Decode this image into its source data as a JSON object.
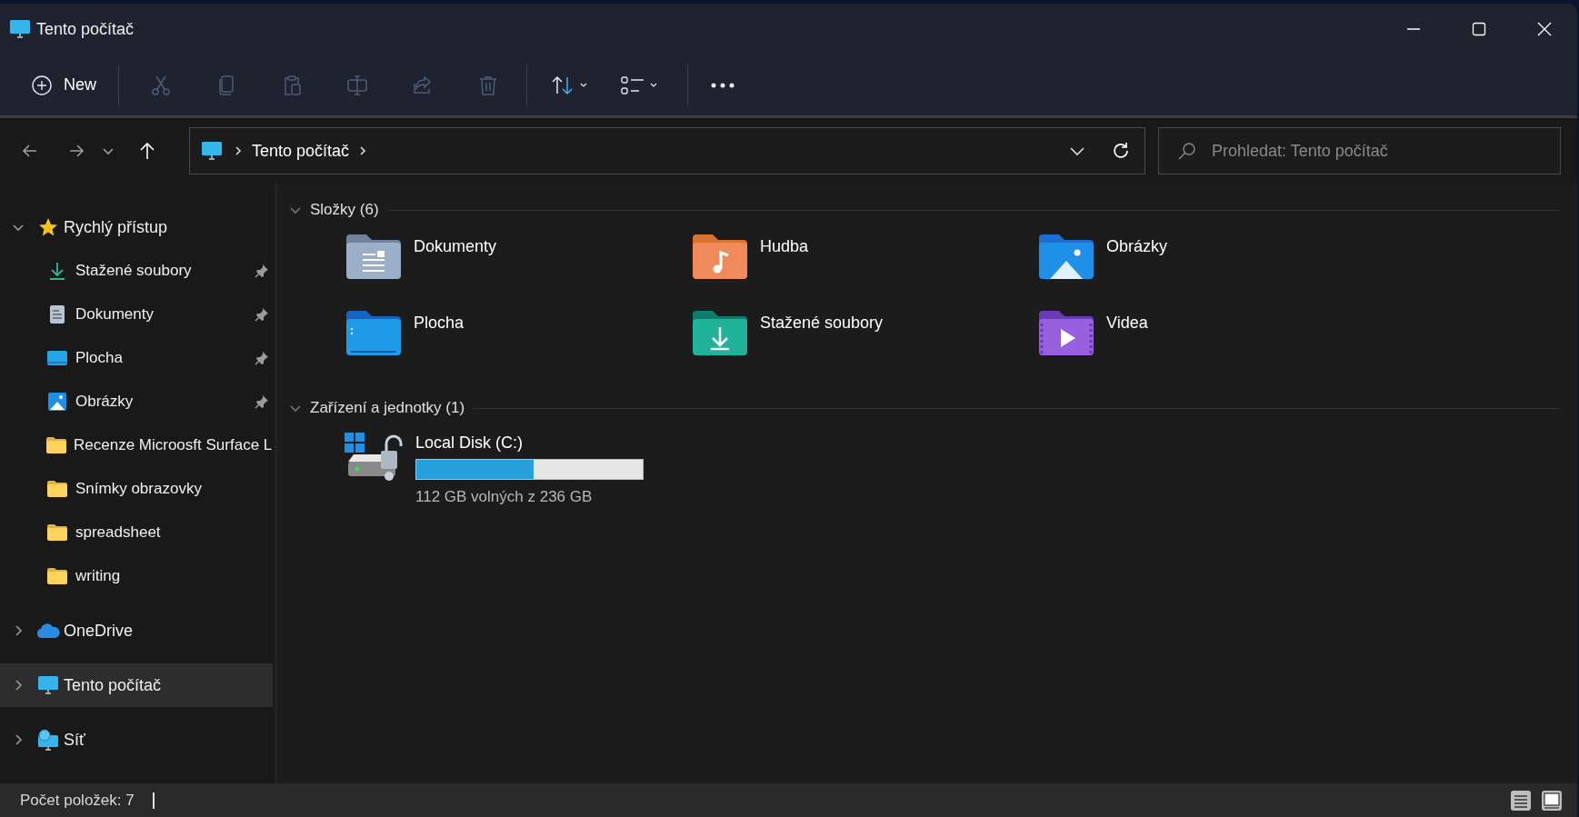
{
  "window": {
    "title": "Tento počítač"
  },
  "toolbar": {
    "items": [
      {
        "kind": "new",
        "label": "New",
        "disabled": false
      },
      {
        "kind": "cut",
        "disabled": true
      },
      {
        "kind": "copy",
        "disabled": true
      },
      {
        "kind": "paste",
        "disabled": true
      },
      {
        "kind": "rename",
        "disabled": true
      },
      {
        "kind": "share",
        "disabled": true
      },
      {
        "kind": "delete",
        "disabled": true
      },
      {
        "kind": "sort",
        "disabled": false
      },
      {
        "kind": "view",
        "disabled": false
      },
      {
        "kind": "more",
        "disabled": false
      }
    ]
  },
  "address_bar": {
    "breadcrumb": [
      "Tento počítač"
    ]
  },
  "search": {
    "placeholder": "Prohledat: Tento počítač"
  },
  "sidebar": {
    "items": [
      {
        "label": "Rychlý přístup",
        "kind": "star",
        "expanded": true,
        "selected": false,
        "children": [
          {
            "label": "Stažené soubory",
            "kind": "downloads",
            "pinned": true,
            "selected": false
          },
          {
            "label": "Dokumenty",
            "kind": "documents",
            "pinned": true,
            "selected": false
          },
          {
            "label": "Plocha",
            "kind": "desktop",
            "pinned": true,
            "selected": false
          },
          {
            "label": "Obrázky",
            "kind": "pictures",
            "pinned": true,
            "selected": false
          },
          {
            "label": "Recenze Microosft Surface L",
            "kind": "folder",
            "pinned": false,
            "selected": false
          },
          {
            "label": "Snímky obrazovky",
            "kind": "folder",
            "pinned": false,
            "selected": false
          },
          {
            "label": "spreadsheet",
            "kind": "folder",
            "pinned": false,
            "selected": false
          },
          {
            "label": "writing",
            "kind": "folder",
            "pinned": false,
            "selected": false
          }
        ]
      },
      {
        "label": "OneDrive",
        "kind": "cloud",
        "expanded": false,
        "selected": false
      },
      {
        "label": "Tento počítač",
        "kind": "pc",
        "expanded": false,
        "selected": true
      },
      {
        "label": "Síť",
        "kind": "network",
        "expanded": false,
        "selected": false
      }
    ]
  },
  "content": {
    "sections": [
      {
        "title": "Složky (6)",
        "kind": "folders",
        "expanded": true,
        "items": [
          {
            "label": "Dokumenty",
            "kind": "documents"
          },
          {
            "label": "Hudba",
            "kind": "music"
          },
          {
            "label": "Obrázky",
            "kind": "pictures"
          },
          {
            "label": "Plocha",
            "kind": "desktop"
          },
          {
            "label": "Stažené soubory",
            "kind": "downloads"
          },
          {
            "label": "Videa",
            "kind": "videos"
          }
        ]
      },
      {
        "title": "Zařízení a jednotky (1)",
        "kind": "drives",
        "expanded": true,
        "items": [
          {
            "label": "Local Disk (C:)",
            "level": 0.52,
            "reading": "112 GB volných z 236 GB"
          }
        ]
      }
    ]
  },
  "status_bar": {
    "text": "Počet položek: 7"
  }
}
